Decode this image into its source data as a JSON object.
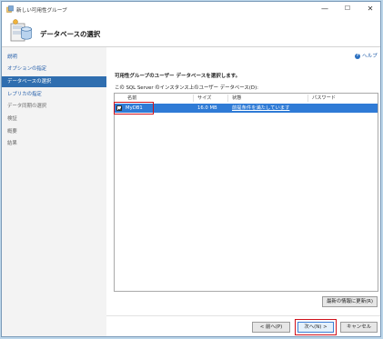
{
  "window": {
    "title": "新しい可用性グループ"
  },
  "header": {
    "title": "データベースの選択"
  },
  "help": {
    "label": "ヘルプ"
  },
  "sidebar": {
    "items": [
      {
        "label": "説明",
        "state": "link"
      },
      {
        "label": "オプションの指定",
        "state": "link"
      },
      {
        "label": "データベースの選択",
        "state": "active"
      },
      {
        "label": "レプリカの指定",
        "state": "link"
      },
      {
        "label": "データ同期の選択",
        "state": "disabled"
      },
      {
        "label": "検証",
        "state": "disabled"
      },
      {
        "label": "概要",
        "state": "disabled"
      },
      {
        "label": "結果",
        "state": "disabled"
      }
    ]
  },
  "main": {
    "instruction": "可用性グループのユーザー データベースを選択します。",
    "list_label": "この SQL Server のインスタンス上のユーザー データベース(D):",
    "columns": [
      "名前",
      "サイズ",
      "状態",
      "パスワード"
    ],
    "rows": [
      {
        "checked": true,
        "name": "MyDB1",
        "size": "16.0 MB",
        "status": "前提条件を満たしています",
        "password": ""
      }
    ]
  },
  "buttons": {
    "refresh": "最新の情報に更新(R)",
    "prev": "< 前へ(P)",
    "next": "次へ(N) >",
    "cancel": "キャンセル"
  },
  "colors": {
    "accent": "#2f6eaf",
    "selection": "#2f7bd6",
    "highlight_box": "#d0121b",
    "link": "#1e5aa8"
  }
}
